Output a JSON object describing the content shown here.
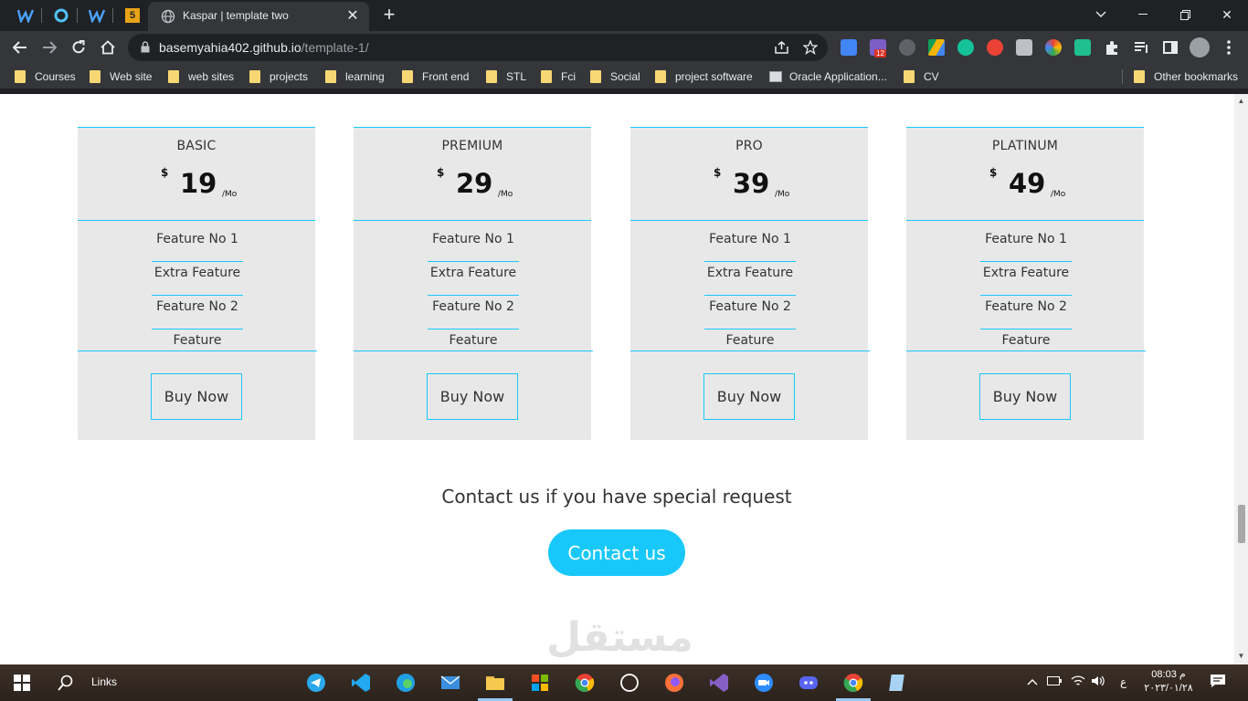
{
  "browser": {
    "tab_title": "Kaspar | template two",
    "url_host": "basemyahia402.github.io",
    "url_path": "/template-1/",
    "extension_badge": "12",
    "pinned_tab_badge": "5"
  },
  "bookmarks": [
    {
      "label": "Courses",
      "type": "folder"
    },
    {
      "label": "Web site",
      "type": "folder"
    },
    {
      "label": "web sites",
      "type": "folder"
    },
    {
      "label": "projects",
      "type": "folder"
    },
    {
      "label": "learning",
      "type": "folder"
    },
    {
      "label": "Front end",
      "type": "folder"
    },
    {
      "label": "STL",
      "type": "folder"
    },
    {
      "label": "Fci",
      "type": "folder"
    },
    {
      "label": "Social",
      "type": "folder"
    },
    {
      "label": "project software",
      "type": "folder"
    },
    {
      "label": "Oracle Application...",
      "type": "page"
    },
    {
      "label": "CV",
      "type": "folder"
    }
  ],
  "other_bookmarks": "Other bookmarks",
  "plans": [
    {
      "name": "BASIC",
      "currency": "$",
      "price": "19",
      "period": "/Mo",
      "features": [
        "Feature No 1",
        "Extra Feature",
        "Feature No 2",
        "Feature"
      ],
      "cta": "Buy Now"
    },
    {
      "name": "PREMIUM",
      "currency": "$",
      "price": "29",
      "period": "/Mo",
      "features": [
        "Feature No 1",
        "Extra Feature",
        "Feature No 2",
        "Feature"
      ],
      "cta": "Buy Now"
    },
    {
      "name": "PRO",
      "currency": "$",
      "price": "39",
      "period": "/Mo",
      "features": [
        "Feature No 1",
        "Extra Feature",
        "Feature No 2",
        "Feature"
      ],
      "cta": "Buy Now"
    },
    {
      "name": "PLATINUM",
      "currency": "$",
      "price": "49",
      "period": "/Mo",
      "features": [
        "Feature No 1",
        "Extra Feature",
        "Feature No 2",
        "Feature"
      ],
      "cta": "Buy Now"
    }
  ],
  "contact": {
    "text": "Contact us if you have special request",
    "button": "Contact us"
  },
  "watermark": "مستقل",
  "taskbar": {
    "links_label": "Links",
    "time": "08:03 م",
    "date": "٢٠٢٣/٠١/٢٨",
    "lang": "ع"
  },
  "colors": {
    "accent": "#19c8fa",
    "card_bg": "#e8e8e8",
    "browser_dark": "#202124",
    "toolbar": "#35363a"
  }
}
